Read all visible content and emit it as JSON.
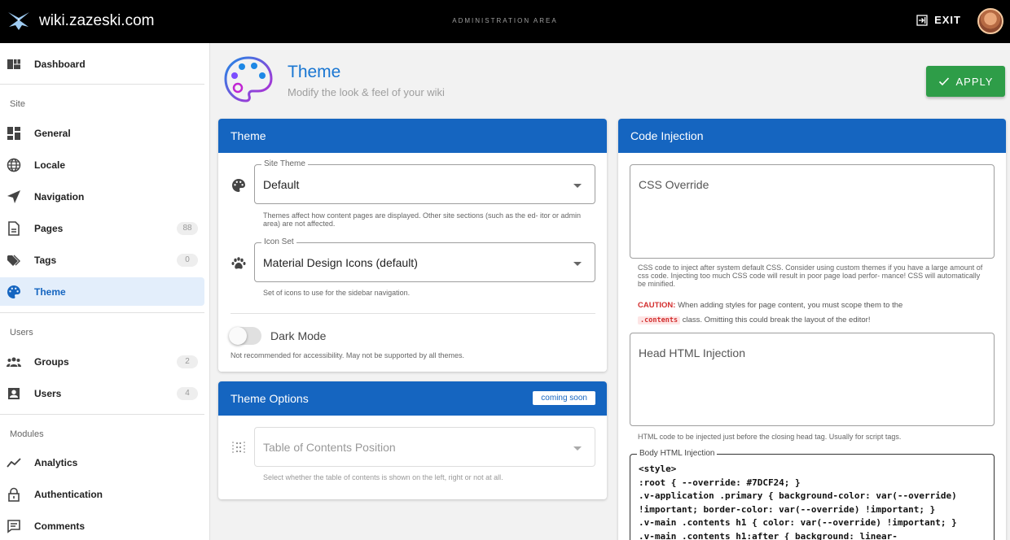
{
  "topbar": {
    "site_name": "wiki.zazeski.com",
    "area_label": "ADMINISTRATION AREA",
    "exit_label": "EXIT"
  },
  "sidebar": {
    "dashboard": "Dashboard",
    "site_header": "Site",
    "items_site": [
      {
        "label": "General",
        "icon": "dashboard-quilt-icon"
      },
      {
        "label": "Locale",
        "icon": "globe-icon"
      },
      {
        "label": "Navigation",
        "icon": "navigation-arrow-icon"
      },
      {
        "label": "Pages",
        "icon": "page-icon",
        "count": "88"
      },
      {
        "label": "Tags",
        "icon": "tag-icon",
        "count": "0"
      },
      {
        "label": "Theme",
        "icon": "palette-icon",
        "active": true
      }
    ],
    "users_header": "Users",
    "items_users": [
      {
        "label": "Groups",
        "icon": "groups-icon",
        "count": "2"
      },
      {
        "label": "Users",
        "icon": "user-box-icon",
        "count": "4"
      }
    ],
    "modules_header": "Modules",
    "items_modules": [
      {
        "label": "Analytics",
        "icon": "analytics-icon"
      },
      {
        "label": "Authentication",
        "icon": "lock-icon"
      },
      {
        "label": "Comments",
        "icon": "comment-icon"
      }
    ]
  },
  "page": {
    "title": "Theme",
    "subtitle": "Modify the look & feel of your wiki",
    "apply_label": "APPLY"
  },
  "theme_card": {
    "title": "Theme",
    "site_theme_label": "Site Theme",
    "site_theme_value": "Default",
    "site_theme_hint": "Themes affect how content pages are displayed. Other site sections (such as the ed- itor or admin area) are not affected.",
    "icon_set_label": "Icon Set",
    "icon_set_value": "Material Design Icons (default)",
    "icon_set_hint": "Set of icons to use for the sidebar navigation.",
    "dark_mode_label": "Dark Mode",
    "dark_mode_on": false,
    "dark_mode_hint": "Not recommended for accessibility. May not be supported by all themes."
  },
  "options_card": {
    "title": "Theme Options",
    "badge": "coming soon",
    "toc_placeholder": "Table of Contents Position",
    "toc_hint": "Select whether the table of contents is shown on the left, right or not at all."
  },
  "injection_card": {
    "title": "Code Injection",
    "css_label": "CSS Override",
    "css_hint": "CSS code to inject after system default CSS. Consider using custom themes if you have a large amount of css code. Injecting too much CSS code will result in poor page load perfor- mance! CSS will automatically be minified.",
    "caution_label": "CAUTION:",
    "caution_text_1": "When adding styles for page content, you must scope them to the",
    "caution_code": ".contents",
    "caution_text_2": "class. Omitting this could break the layout of the editor!",
    "head_label": "Head HTML Injection",
    "head_hint": "HTML code to be injected just before the closing head tag. Usually for script tags.",
    "body_label": "Body HTML Injection",
    "body_code": "<style>\n:root { --override: #7DCF24; }\n.v-application .primary { background-color: var(--override)\n!important; border-color: var(--override) !important; }\n.v-main .contents h1 { color: var(--override) !important; }\n.v-main .contents h1:after { background: linear-"
  },
  "colors": {
    "primary": "#1565c0",
    "apply_green": "#2e9d48",
    "caution_red": "#d32f2f"
  }
}
